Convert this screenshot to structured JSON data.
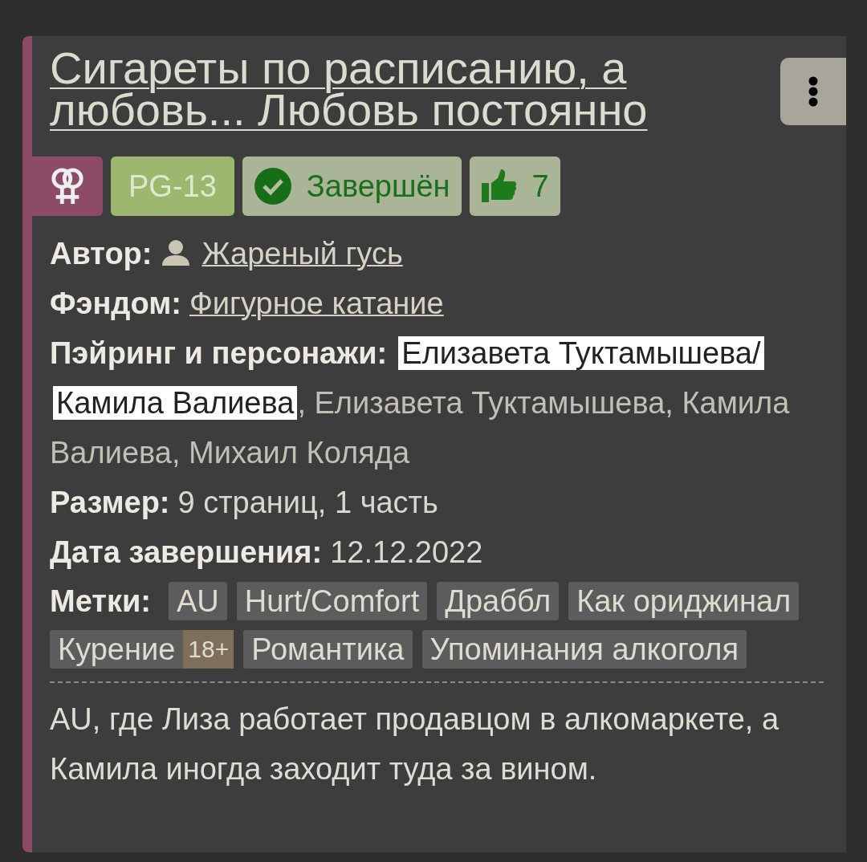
{
  "title": "Сигареты по расписанию, а любовь... Любовь постоянно",
  "badges": [
    {
      "kind": "direction"
    },
    {
      "kind": "rating",
      "label": "PG-13"
    },
    {
      "kind": "status",
      "label": "Завершён"
    },
    {
      "kind": "likes",
      "label": "7"
    }
  ],
  "fields": [
    {
      "kind": "author",
      "label": "Автор:",
      "value": "Жареный гусь"
    },
    {
      "kind": "link",
      "label": "Фэндом:",
      "value": "Фигурное катание"
    },
    {
      "kind": "pairings",
      "label": "Пэйринг и персонажи:",
      "pairing": "Елизавета Туктамышева/Камила Валиева",
      "characters": ", Елизавета Туктамышева, Камила Валиева, Михаил Коляда"
    },
    {
      "kind": "plain",
      "label": "Размер:",
      "value": "9 страниц, 1 часть"
    },
    {
      "kind": "plain",
      "label": "Дата завершения:",
      "value": "12.12.2022"
    }
  ],
  "tags": {
    "label": "Метки:",
    "items": [
      {
        "label": "AU"
      },
      {
        "label": "Hurt/Comfort"
      },
      {
        "label": "Драббл"
      },
      {
        "label": "Как ориджинал"
      },
      {
        "label": "Курение",
        "marker": "18+"
      },
      {
        "label": "Романтика"
      },
      {
        "label": "Упоминания алкоголя"
      }
    ]
  },
  "description": "AU, где Лиза работает продавцом в алкомаркете, а Камила иногда заходит туда за вином."
}
